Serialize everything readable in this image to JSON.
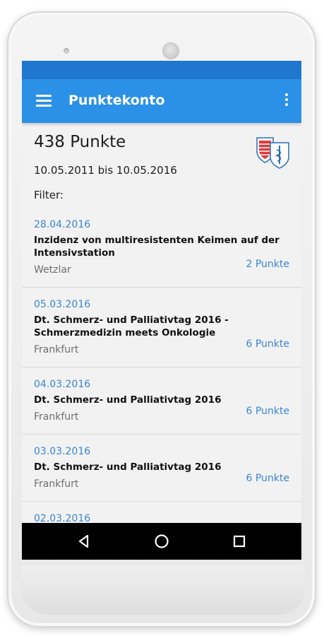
{
  "app_bar": {
    "title": "Punktekonto",
    "menu_icon": "hamburger-menu-icon",
    "overflow_icon": "more-vertical-icon",
    "color": "#2b91e6",
    "status_bar_color": "#1f77cf"
  },
  "summary": {
    "points_total": "438 Punkte",
    "date_range": "10.05.2011 bis 10.05.2016",
    "filter_label": "Filter:",
    "crest_icon": "coat-of-arms-icon"
  },
  "entries": [
    {
      "date": "28.04.2016",
      "title": "Inzidenz von multiresistenten Keimen auf der Intensivstation",
      "place": "Wetzlar",
      "points": "2 Punkte"
    },
    {
      "date": "05.03.2016",
      "title": "Dt. Schmerz- und Palliativtag 2016 - Schmerzmedizin meets Onkologie",
      "place": "Frankfurt",
      "points": "6 Punkte"
    },
    {
      "date": "04.03.2016",
      "title": "Dt. Schmerz- und Palliativtag 2016",
      "place": "Frankfurt",
      "points": "6 Punkte"
    },
    {
      "date": "03.03.2016",
      "title": "Dt. Schmerz- und Palliativtag 2016",
      "place": "Frankfurt",
      "points": "6 Punkte"
    },
    {
      "date": "02.03.2016"
    }
  ],
  "nav_bar": {
    "back_icon": "back-triangle-icon",
    "home_icon": "home-circle-icon",
    "recent_icon": "recent-apps-square-icon"
  },
  "colors": {
    "accent": "#3a86cf",
    "text": "#1e1e1e",
    "muted": "#6d6d6d"
  }
}
